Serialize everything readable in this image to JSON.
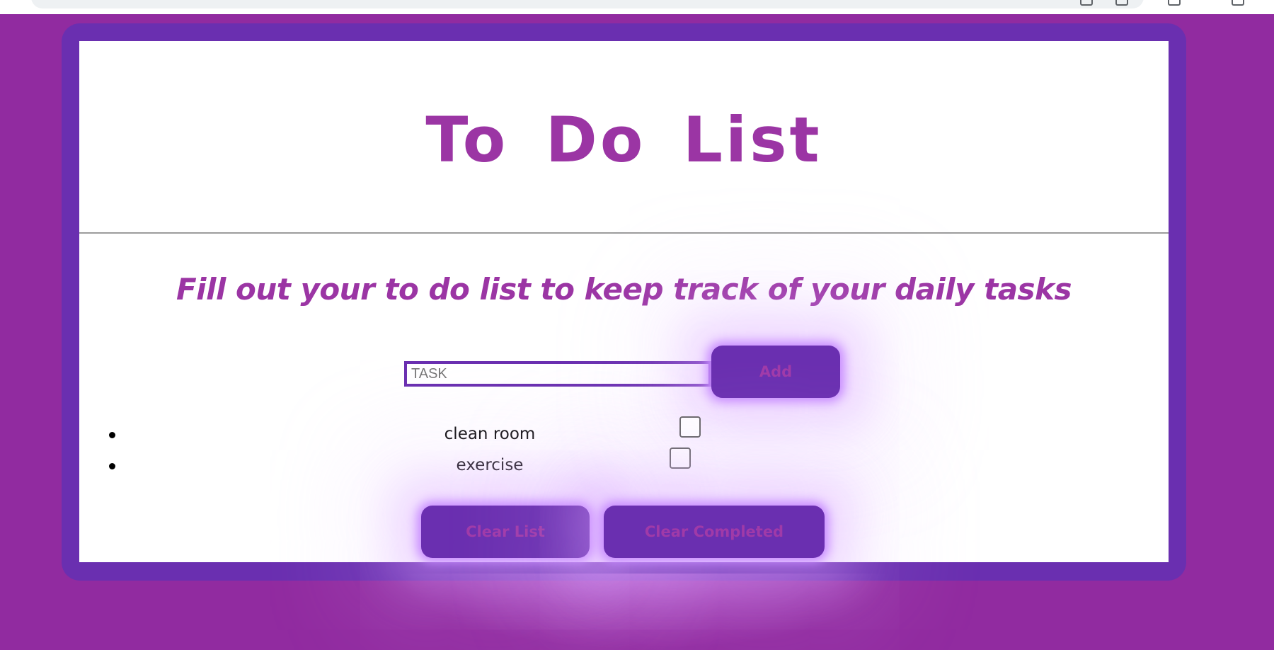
{
  "app": {
    "title": "To Do List",
    "subtitle": "Fill out your to do list to keep track of your daily tasks"
  },
  "form": {
    "task_placeholder": "TASK",
    "task_value": "",
    "add_label": "Add"
  },
  "tasks": [
    {
      "text": "clean room",
      "completed": false
    },
    {
      "text": "exercise",
      "completed": false
    }
  ],
  "actions": {
    "clear_list_label": "Clear List",
    "clear_completed_label": "Clear Completed"
  },
  "colors": {
    "page_background": "#912ba0",
    "frame": "#6a2fb0",
    "accent_text": "#9b35a4",
    "button_glow": "#c88cff"
  }
}
